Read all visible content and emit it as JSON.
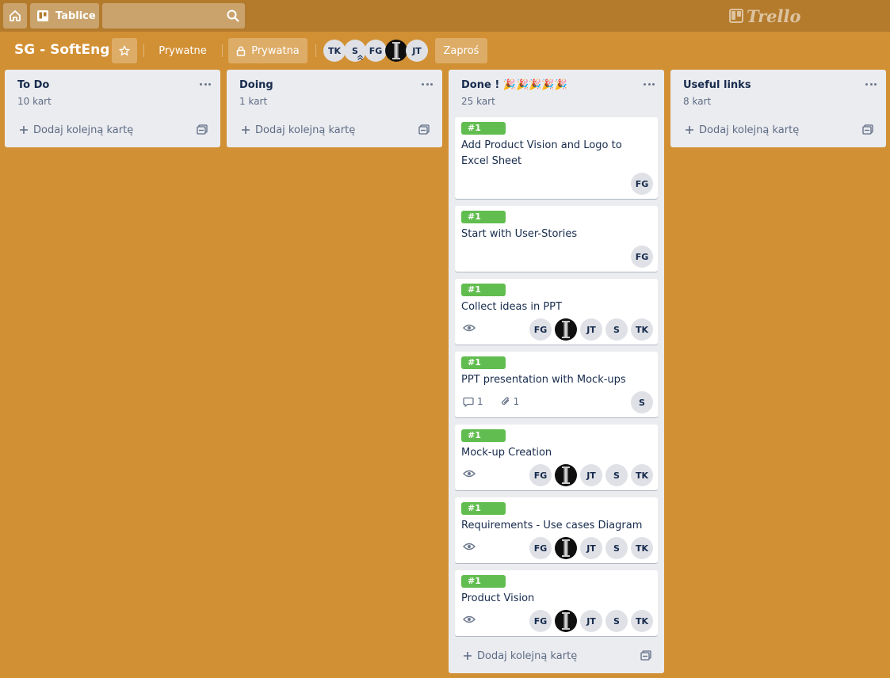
{
  "header": {
    "boards_label": "Tablice",
    "search_value": "",
    "logo_text": "Trello"
  },
  "board": {
    "title": "SG - SoftEng",
    "team_label": "Prywatne",
    "visibility_label": "Prywatna",
    "invite_label": "Zaproś",
    "members": [
      "TK",
      "S",
      "FG",
      "",
      "JT"
    ]
  },
  "lists": [
    {
      "title": "To Do",
      "count": "10 kart",
      "add_label": "Dodaj kolejną kartę"
    },
    {
      "title": "Doing",
      "count": "1 kart",
      "add_label": "Dodaj kolejną kartę"
    },
    {
      "title": "Done ! 🎉🎉🎉🎉🎉",
      "count": "25 kart",
      "add_label": "Dodaj kolejną kartę"
    },
    {
      "title": "Useful links",
      "count": "8 kart",
      "add_label": "Dodaj kolejną kartę"
    }
  ],
  "cards": [
    {
      "label": "#1",
      "title": "Add Product Vision and Logo to Excel Sheet",
      "members": [
        "FG"
      ]
    },
    {
      "label": "#1",
      "title": "Start with User-Stories",
      "members": [
        "FG"
      ]
    },
    {
      "label": "#1",
      "title": "Collect ideas in PPT",
      "watching": true,
      "members": [
        "FG",
        "",
        "JT",
        "S",
        "TK"
      ]
    },
    {
      "label": "#1",
      "title": "PPT presentation with Mock-ups",
      "comments": "1",
      "attachments": "1",
      "members": [
        "S"
      ]
    },
    {
      "label": "#1",
      "title": "Mock-up Creation",
      "watching": true,
      "members": [
        "FG",
        "",
        "JT",
        "S",
        "TK"
      ]
    },
    {
      "label": "#1",
      "title": "Requirements - Use cases Diagram",
      "watching": true,
      "members": [
        "FG",
        "",
        "JT",
        "S",
        "TK"
      ]
    },
    {
      "label": "#1",
      "title": "Product Vision",
      "watching": true,
      "members": [
        "FG",
        "",
        "JT",
        "S",
        "TK"
      ]
    }
  ],
  "colors": {
    "board_background": "#d29034",
    "header_background": "#b47b2d",
    "list_background": "#ebecf0",
    "label_green": "#61bd4f"
  },
  "icons": {
    "home": "home-icon",
    "boards": "boards-icon",
    "search": "search-icon",
    "star": "star-icon",
    "lock": "lock-icon",
    "menu": "more-icon",
    "add": "plus-icon",
    "template": "card-template-icon",
    "watch": "eye-icon",
    "comment": "comment-icon",
    "attachment": "paperclip-icon"
  }
}
